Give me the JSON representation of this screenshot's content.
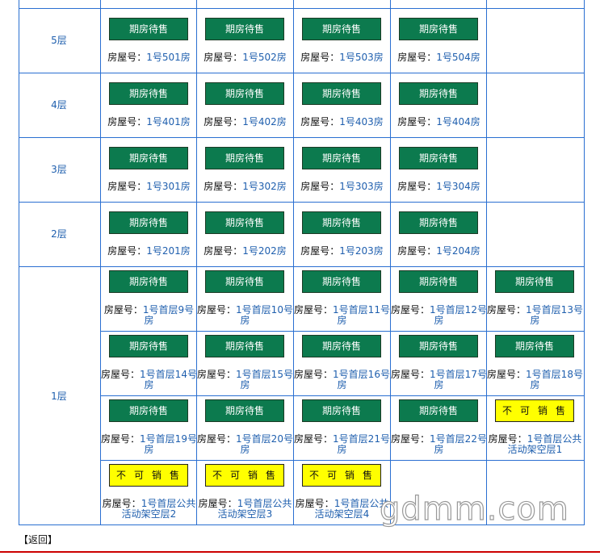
{
  "buttons": {
    "available": "期房待售",
    "not_for_sale": "不可销售"
  },
  "house_no_label": "房屋号：",
  "floors": [
    {
      "label": "5层",
      "units": [
        "1号501房",
        "1号502房",
        "1号503房",
        "1号504房"
      ]
    },
    {
      "label": "4层",
      "units": [
        "1号401房",
        "1号402房",
        "1号403房",
        "1号404房"
      ]
    },
    {
      "label": "3层",
      "units": [
        "1号301房",
        "1号302房",
        "1号303房",
        "1号304房"
      ]
    },
    {
      "label": "2层",
      "units": [
        "1号201房",
        "1号202房",
        "1号203房",
        "1号204房"
      ]
    },
    {
      "label": "1层",
      "units": []
    }
  ],
  "ground_rows": [
    [
      "1号首层9号房",
      "1号首层10号房",
      "1号首层11号房",
      "1号首层12号房",
      "1号首层13号房"
    ],
    [
      "1号首层14号房",
      "1号首层15号房",
      "1号首层16号房",
      "1号首层17号房",
      "1号首层18号房"
    ],
    [
      "1号首层19号房",
      "1号首层20号房",
      "1号首层21号房",
      "1号首层22号房",
      "1号首层公共活动架空层1"
    ],
    [
      "1号首层公共活动架空层2",
      "1号首层公共活动架空层3",
      "1号首层公共活动架空层4"
    ]
  ],
  "back_link": "【返回】",
  "watermark": "gdmm.com"
}
